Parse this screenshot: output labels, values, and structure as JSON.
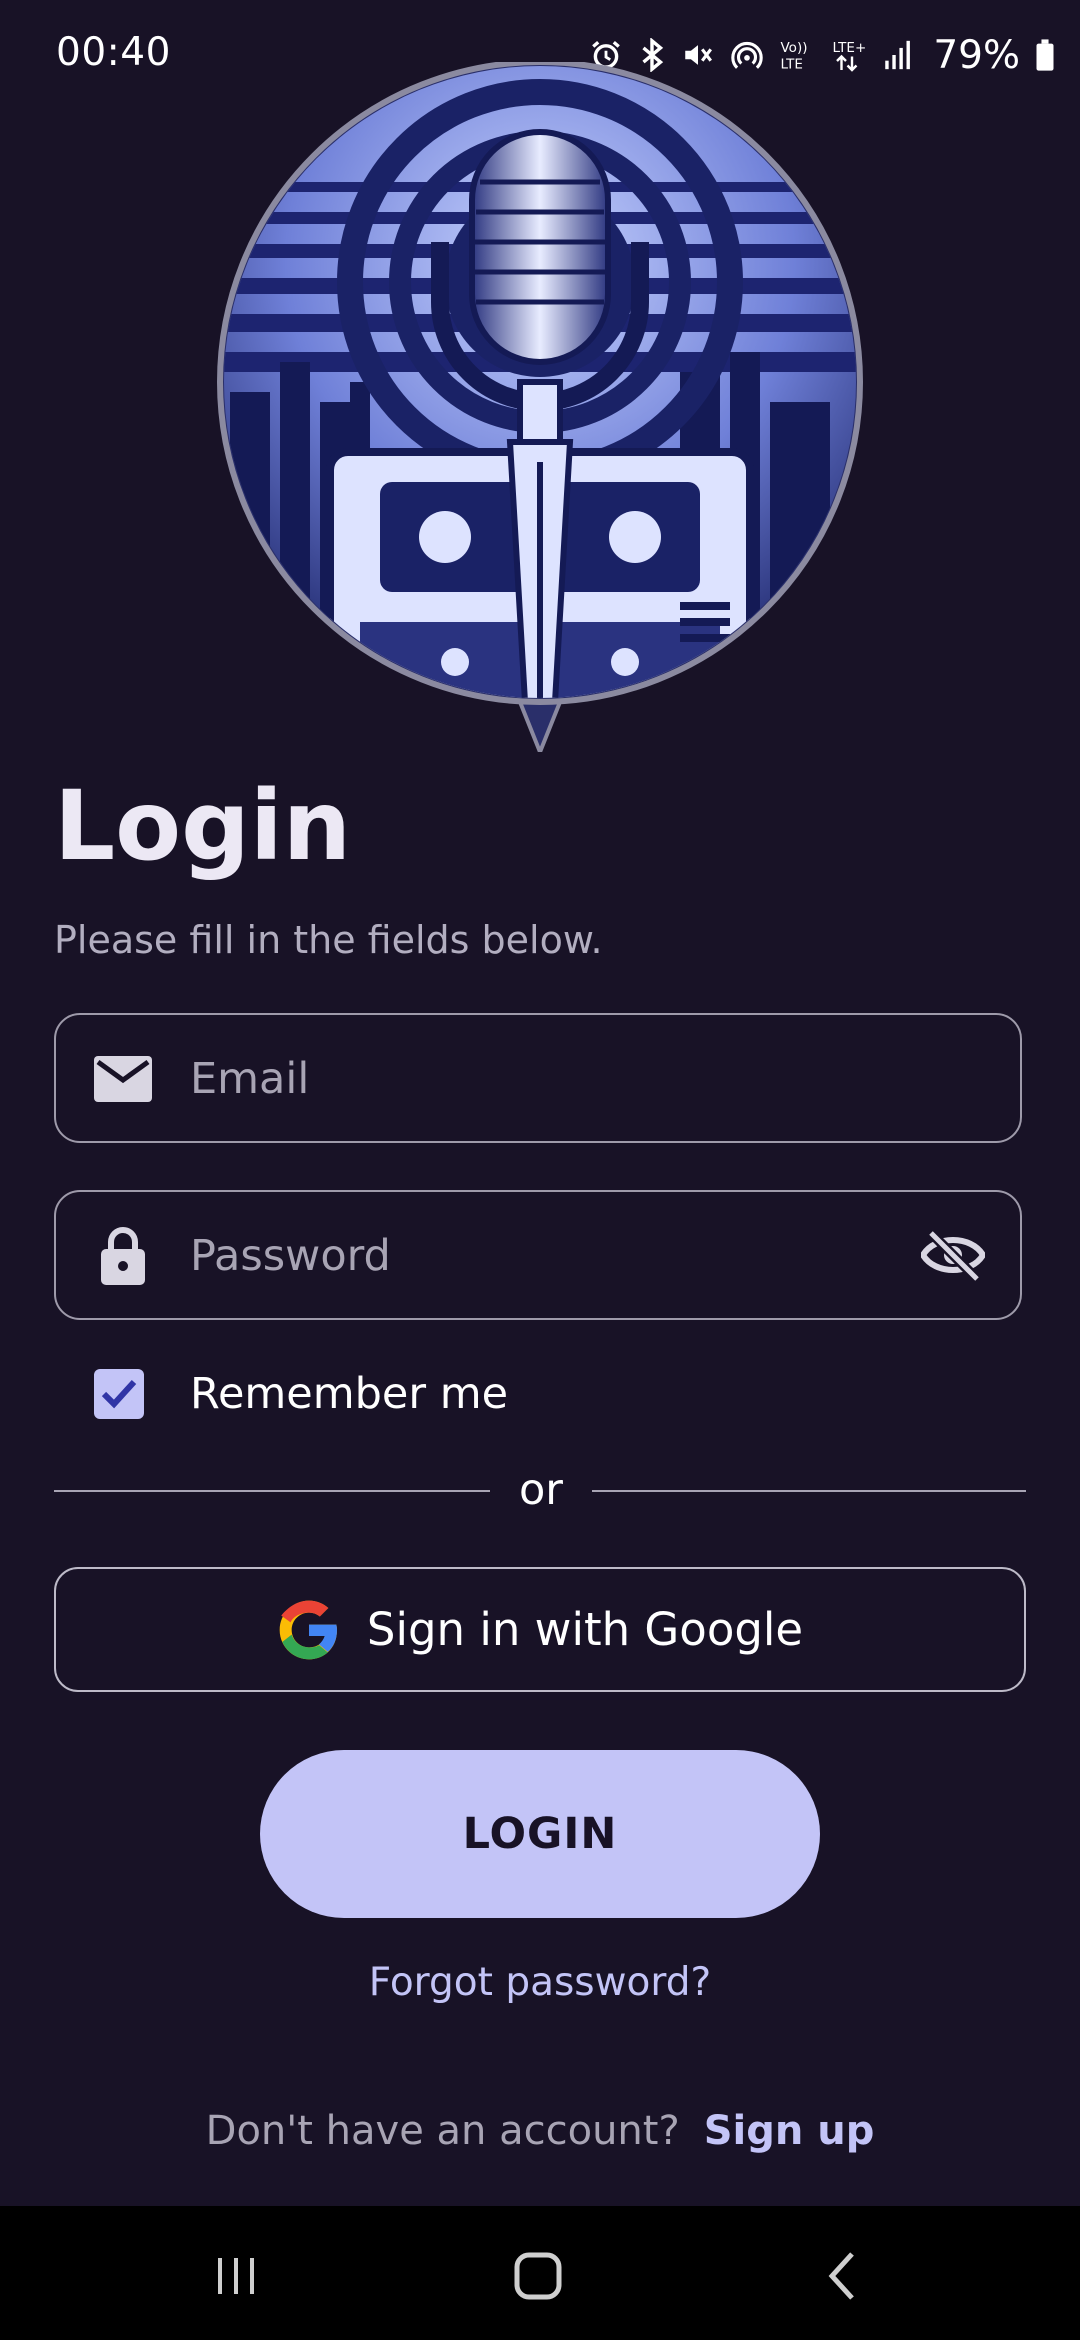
{
  "status_bar": {
    "time": "00:40",
    "battery_percent": "79%",
    "icons": [
      "alarm-icon",
      "bluetooth-icon",
      "mute-icon",
      "hotspot-icon",
      "volte-icon",
      "lte-icon",
      "signal-icon",
      "battery-icon"
    ]
  },
  "logo": {
    "icon": "podcast-microphone-cassette-logo"
  },
  "header": {
    "title": "Login",
    "subtitle": "Please fill in the fields below."
  },
  "form": {
    "email": {
      "placeholder": "Email",
      "value": "",
      "icon": "mail-icon"
    },
    "password": {
      "placeholder": "Password",
      "value": "",
      "icon": "lock-icon",
      "toggle_icon": "eye-off-icon"
    },
    "remember_me": {
      "label": "Remember me",
      "checked": true
    }
  },
  "divider": {
    "label": "or"
  },
  "google_button": {
    "label": "Sign in with Google",
    "icon": "google-icon"
  },
  "login_button": {
    "label": "LOGIN"
  },
  "forgot_password": {
    "label": "Forgot password?"
  },
  "signup": {
    "prompt": "Don't have an account?",
    "link": "Sign up"
  },
  "nav_bar": {
    "buttons": [
      "recents-icon",
      "home-icon",
      "back-icon"
    ]
  },
  "colors": {
    "background": "#181226",
    "accent": "#c3c4f7",
    "muted_text": "#a8a4b4",
    "border": "#9e9aaa"
  }
}
